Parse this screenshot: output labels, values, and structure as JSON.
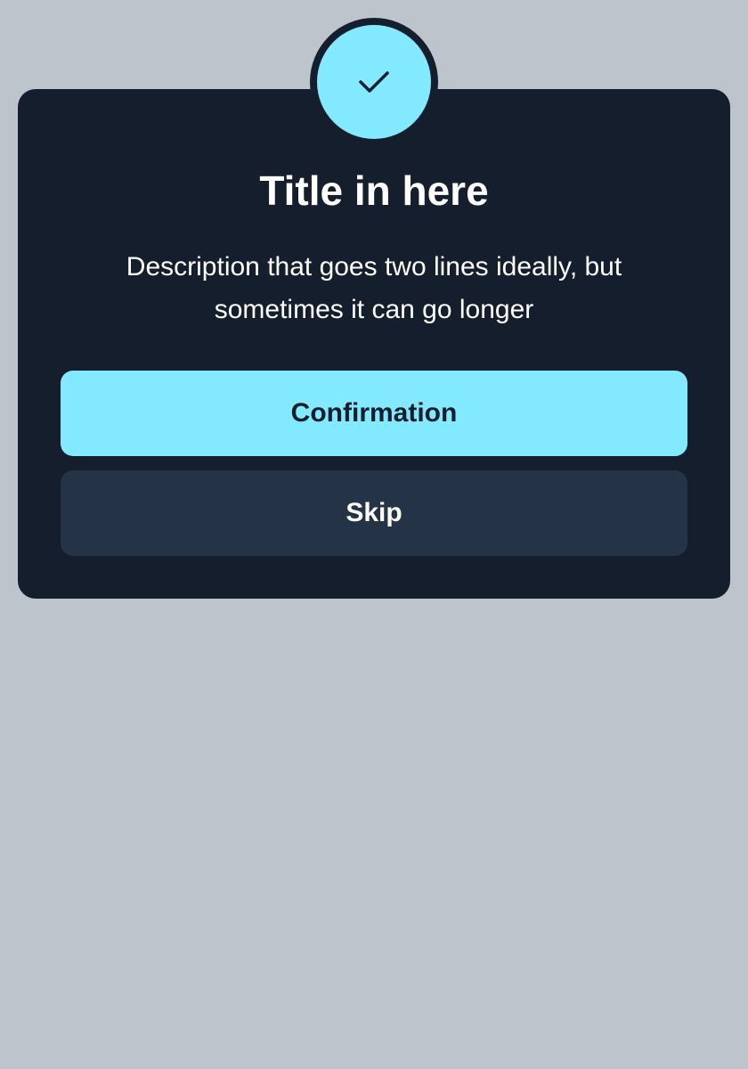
{
  "dialog": {
    "icon": "checkmark-icon",
    "title": "Title in here",
    "description": "Description that goes two lines ideally, but sometimes it can go longer",
    "primary_button_label": "Confirmation",
    "secondary_button_label": "Skip"
  },
  "colors": {
    "page_background": "#bdc4cc",
    "dialog_background": "#151e2c",
    "accent": "#83e9ff",
    "secondary_button": "#243346",
    "text_light": "#ffffff",
    "text_dark": "#151e2c"
  }
}
